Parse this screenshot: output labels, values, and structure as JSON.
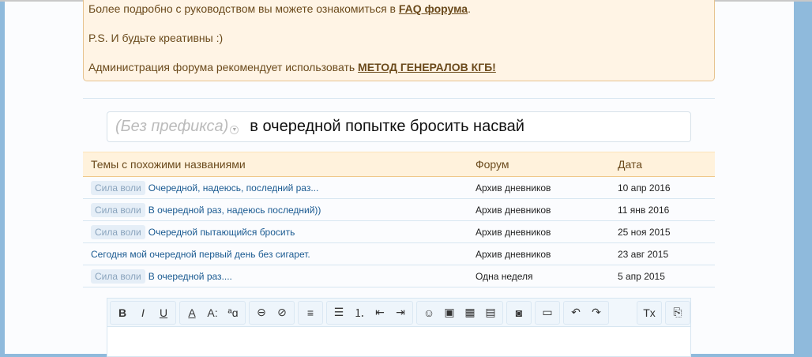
{
  "notice": {
    "line1": "Более подробно с руководством вы можете ознакомиться в ",
    "faq_link": "FAQ форума",
    "line1_end": ".",
    "line2": "P.S. И будьте креативны :)",
    "line3": "Администрация форума рекомендует использовать ",
    "kgb_link": "МЕТОД ГЕНЕРАЛОВ КГБ!"
  },
  "title_field": {
    "prefix": "(Без префикса)",
    "value": "в очередной попытке бросить насвай"
  },
  "similar": {
    "headers": [
      "Темы с похожими названиями",
      "Форум",
      "Дата"
    ],
    "rows": [
      {
        "prefix": "Сила воли",
        "title": "Очередной, надеюсь, последний раз...",
        "forum": "Архив дневников",
        "date": "10 апр 2016"
      },
      {
        "prefix": "Сила воли",
        "title": "В очередной раз, надеюсь последний))",
        "forum": "Архив дневников",
        "date": "11 янв 2016"
      },
      {
        "prefix": "Сила воли",
        "title": "Очередной пытающийся бросить",
        "forum": "Архив дневников",
        "date": "25 ноя 2015"
      },
      {
        "prefix": null,
        "title": "Сегодня мой очередной первый день без сигарет.",
        "forum": "Архив дневников",
        "date": "23 авг 2015"
      },
      {
        "prefix": "Сила воли",
        "title": "В очередной раз....",
        "forum": "Одна неделя",
        "date": "5 апр 2015"
      }
    ]
  },
  "toolbar": {
    "bold": "B",
    "italic": "I",
    "underline": "U",
    "color": "A",
    "size": "A:",
    "font": "ªɑ",
    "link": "⊖",
    "unlink": "⊘",
    "align": "≡",
    "ul": "☰",
    "ol": "⒈",
    "outdent": "⇤",
    "indent": "⇥",
    "smilie": "☺",
    "image": "▣",
    "media": "▦",
    "quote": "▤",
    "camera": "◙",
    "save": "▭",
    "undo": "↶",
    "redo": "↷",
    "clear": "Tx",
    "source": "⎘"
  }
}
